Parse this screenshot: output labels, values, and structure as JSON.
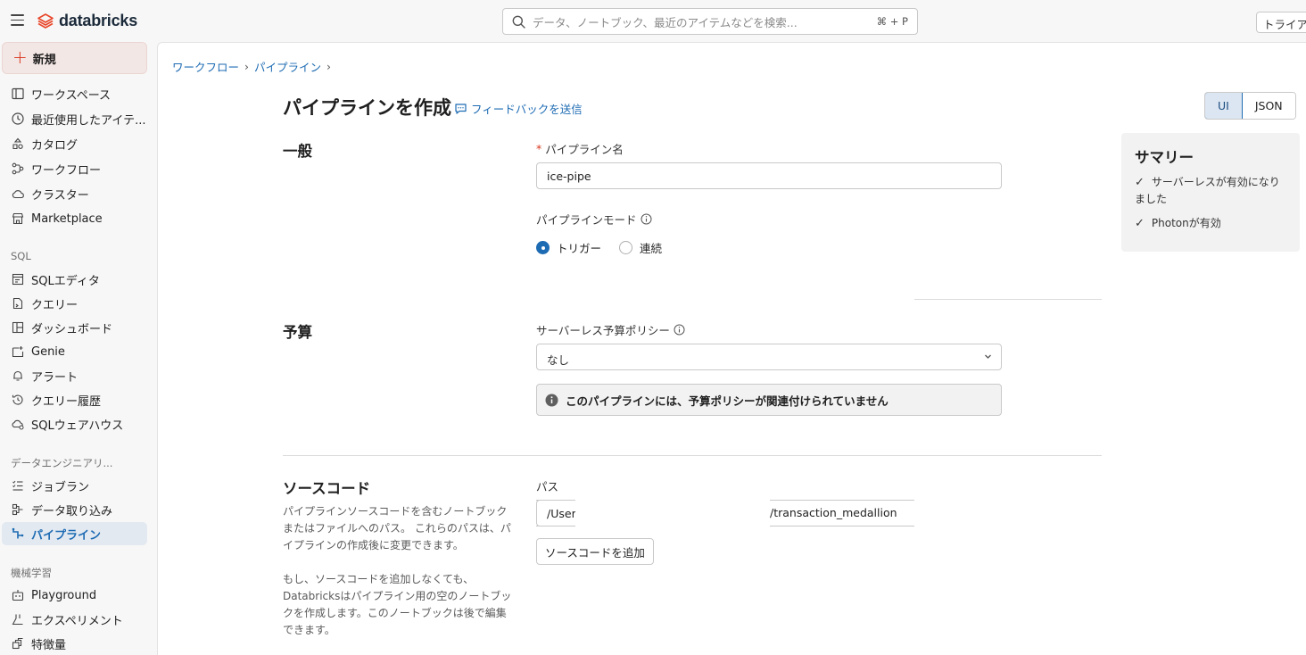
{
  "topbar": {
    "logo_text": "databricks",
    "search_placeholder": "データ、ノートブック、最近のアイテムなどを検索...",
    "search_shortcut": "⌘ + P",
    "trial_label": "トライアル"
  },
  "sidebar": {
    "new_label": "新規",
    "items_main": [
      {
        "label": "ワークスペース",
        "icon": "workspace-icon"
      },
      {
        "label": "最近使用したアイテ...",
        "icon": "clock-icon"
      },
      {
        "label": "カタログ",
        "icon": "catalog-icon"
      },
      {
        "label": "ワークフロー",
        "icon": "workflow-icon"
      },
      {
        "label": "クラスター",
        "icon": "cloud-icon"
      },
      {
        "label": "Marketplace",
        "icon": "store-icon"
      }
    ],
    "section_sql": "SQL",
    "items_sql": [
      {
        "label": "SQLエディタ",
        "icon": "sql-editor-icon"
      },
      {
        "label": "クエリー",
        "icon": "query-icon"
      },
      {
        "label": "ダッシュボード",
        "icon": "dashboard-icon"
      },
      {
        "label": "Genie",
        "icon": "genie-icon"
      },
      {
        "label": "アラート",
        "icon": "bell-icon"
      },
      {
        "label": "クエリー履歴",
        "icon": "history-icon"
      },
      {
        "label": "SQLウェアハウス",
        "icon": "warehouse-icon"
      }
    ],
    "section_de": "データエンジニアリ...",
    "items_de": [
      {
        "label": "ジョブラン",
        "icon": "job-runs-icon"
      },
      {
        "label": "データ取り込み",
        "icon": "ingest-icon"
      },
      {
        "label": "パイプライン",
        "icon": "pipeline-icon",
        "active": true
      }
    ],
    "section_ml": "機械学習",
    "items_ml": [
      {
        "label": "Playground",
        "icon": "robot-icon"
      },
      {
        "label": "エクスペリメント",
        "icon": "flask-icon"
      },
      {
        "label": "特徴量",
        "icon": "features-icon"
      }
    ]
  },
  "breadcrumb": {
    "items": [
      "ワークフロー",
      "パイプライン"
    ],
    "separator": "›"
  },
  "page": {
    "title": "パイプラインを作成",
    "feedback_link": "フィードバックを送信",
    "toggle": {
      "ui": "UI",
      "json": "JSON",
      "selected": "UI"
    }
  },
  "general": {
    "section_title": "一般",
    "name_label": "パイプライン名",
    "name_required_mark": "*",
    "name_value": "ice-pipe",
    "mode_label": "パイプラインモード",
    "mode_options": [
      "トリガー",
      "連続"
    ],
    "mode_selected": "トリガー"
  },
  "budget": {
    "section_title": "予算",
    "policy_label": "サーバーレス予算ポリシー",
    "policy_value": "なし",
    "alert_text": "このパイプラインには、予算ポリシーが関連付けられていません"
  },
  "source": {
    "section_title": "ソースコード",
    "description_1": "パイプラインソースコードを含むノートブックまたはファイルへのパス。 これらのパスは、パイプラインの作成後に変更できます。",
    "description_2": "もし、ソースコードを追加しなくても、Databricksはパイプライン用の空のノートブックを作成します。このノートブックは後で編集できます。",
    "path_label": "パス",
    "path_value_start": "/Users",
    "path_value_end": "/transaction_medallion",
    "add_button": "ソースコードを追加"
  },
  "summary": {
    "title": "サマリー",
    "items": [
      "サーバーレスが有効になりました",
      "Photonが有効"
    ]
  },
  "colors": {
    "accent": "#1d6bb3",
    "brand": "#d9371e",
    "active_bg": "#e3e9f1"
  }
}
